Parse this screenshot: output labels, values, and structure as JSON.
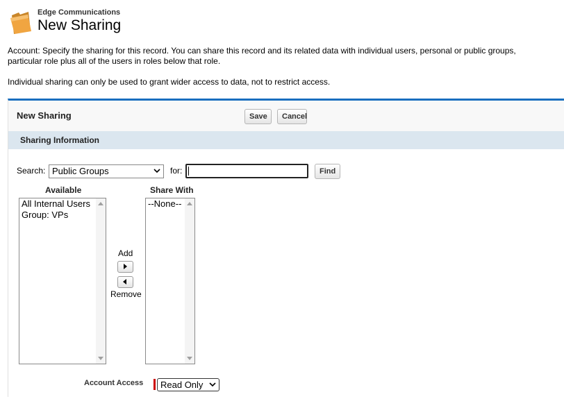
{
  "header": {
    "object_label": "Edge Communications",
    "title": "New Sharing",
    "icon": "folder-icon"
  },
  "description": {
    "line1": "Account: Specify the sharing for this record. You can share this record and its related data with individual users, personal or public groups,",
    "line2": "particular role plus all of the users in roles below that role.",
    "line3": "Individual sharing can only be used to grant wider access to data, not to restrict access."
  },
  "panel": {
    "title": "New Sharing",
    "save_label": "Save",
    "cancel_label": "Cancel",
    "accent_color": "#1a6fbf"
  },
  "section": {
    "title": "Sharing Information"
  },
  "search": {
    "label": "Search:",
    "selected": "Public Groups",
    "for_label": "for:",
    "value": "",
    "find_label": "Find"
  },
  "available": {
    "heading": "Available",
    "items": [
      "All Internal Users",
      "Group: VPs"
    ]
  },
  "share_with": {
    "heading": "Share With",
    "items": [
      "--None--"
    ]
  },
  "move": {
    "add_label": "Add",
    "remove_label": "Remove"
  },
  "access": {
    "label": "Account Access",
    "selected": "Read Only"
  }
}
